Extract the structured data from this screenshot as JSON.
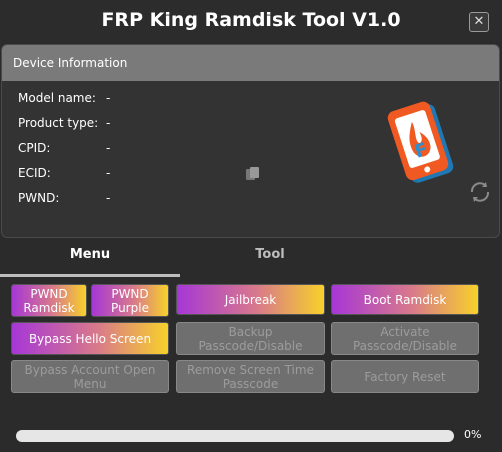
{
  "window": {
    "title": "FRP King Ramdisk Tool V1.0",
    "close_label": "✕"
  },
  "device": {
    "header": "Device Information",
    "rows": [
      {
        "label": "Model name:",
        "value": "-"
      },
      {
        "label": "Product type:",
        "value": "-"
      },
      {
        "label": "CPID:",
        "value": "-"
      },
      {
        "label": "ECID:",
        "value": "-"
      },
      {
        "label": "PWND:",
        "value": "-"
      }
    ]
  },
  "tabs": {
    "menu": "Menu",
    "tool": "Tool"
  },
  "buttons": {
    "pwnd_ramdisk": "PWND\nRamdisk",
    "pwnd_purple": "PWND\nPurple",
    "jailbreak": "Jailbreak",
    "boot_ramdisk": "Boot Ramdisk",
    "bypass_hello": "Bypass Hello Screen",
    "backup_passcode": "Backup\nPasscode/Disable",
    "activate_passcode": "Activate\nPasscode/Disable",
    "bypass_account": "Bypass Account Open\nMenu",
    "remove_screen_time": "Remove Screen Time\nPasscode",
    "factory_reset": "Factory Reset"
  },
  "progress": {
    "value": 0,
    "label": "0%"
  },
  "colors": {
    "accent_start": "#a637d6",
    "accent_end": "#f7d12a",
    "logo_orange": "#f05a22",
    "logo_blue": "#2a8fd0"
  },
  "icons": [
    "close-icon",
    "copy-icon",
    "app-logo",
    "refresh-icon"
  ]
}
